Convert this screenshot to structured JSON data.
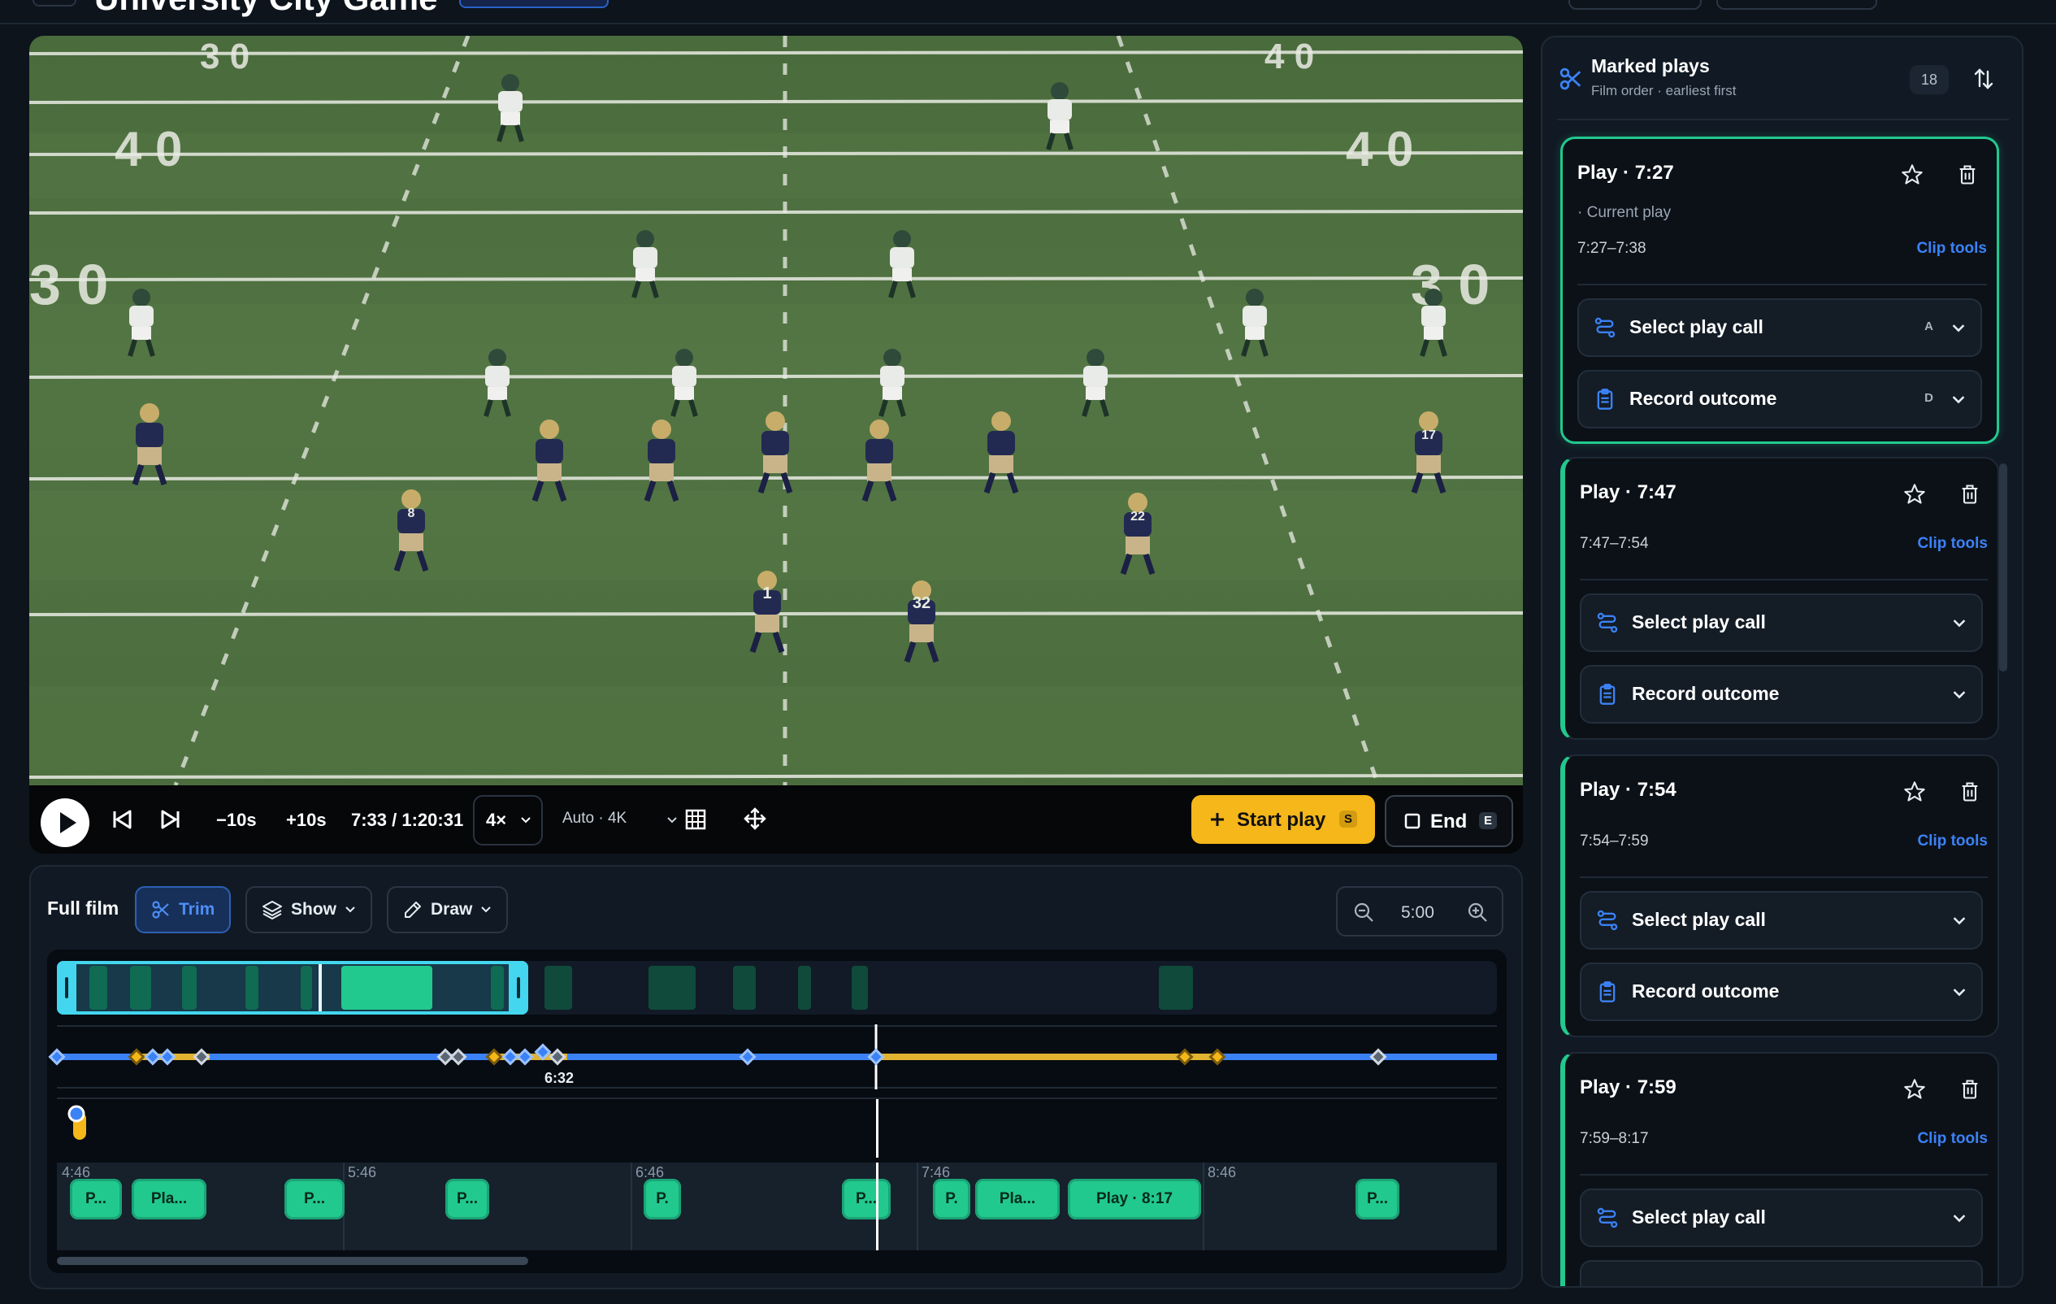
{
  "header": {
    "title": "University City Game"
  },
  "player": {
    "back10": "−10s",
    "fwd10": "+10s",
    "time": "7:33 / 1:20:31",
    "speed": "4×",
    "quality": "Auto · 4K",
    "start_label": "Start play",
    "start_key": "S",
    "end_label": "End",
    "end_key": "E",
    "jersey_numbers": [
      "1",
      "32",
      "22",
      "17",
      "8"
    ]
  },
  "timeline": {
    "label": "Full film",
    "trim": "Trim",
    "show": "Show",
    "draw": "Draw",
    "zoom_value": "5:00",
    "cursor_time": "6:32",
    "ticks": [
      "4:46",
      "5:46",
      "6:46",
      "7:46",
      "8:46"
    ],
    "chips": [
      "P...",
      "Pla...",
      "P...",
      "P...",
      "P.",
      "P...",
      "P.",
      "Pla...",
      "Play · 8:17",
      "P..."
    ]
  },
  "side": {
    "title": "Marked plays",
    "subtitle": "Film order · earliest first",
    "count": "18",
    "cards": [
      {
        "title": "Play · 7:27",
        "current": "· Current play",
        "range": "7:27–7:38",
        "clip": "Clip tools",
        "call": "Select play call",
        "call_key": "A",
        "outcome": "Record outcome",
        "outcome_key": "D"
      },
      {
        "title": "Play · 7:47",
        "range": "7:47–7:54",
        "clip": "Clip tools",
        "call": "Select play call",
        "outcome": "Record outcome"
      },
      {
        "title": "Play · 7:54",
        "range": "7:54–7:59",
        "clip": "Clip tools",
        "call": "Select play call",
        "outcome": "Record outcome"
      },
      {
        "title": "Play · 7:59",
        "range": "7:59–8:17",
        "clip": "Clip tools",
        "call": "Select play call"
      }
    ]
  },
  "colors": {
    "accent": "#22c98e",
    "brand_blue": "#3b82f6",
    "start_yellow": "#f5b719"
  }
}
